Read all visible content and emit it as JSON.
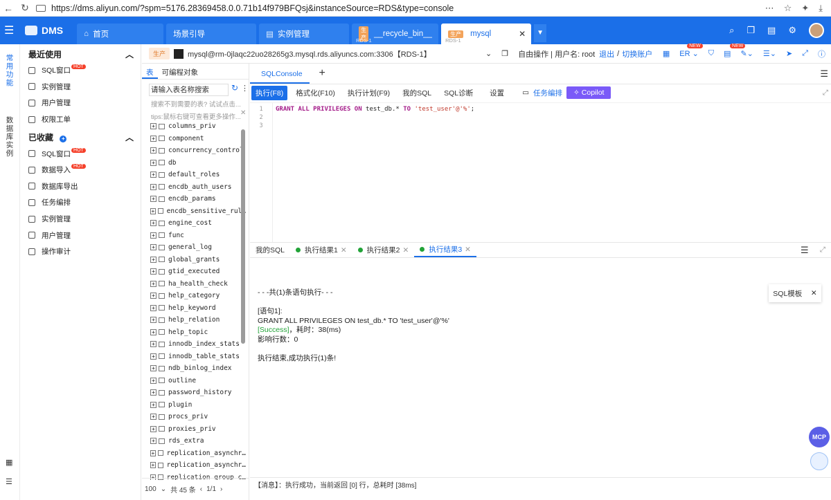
{
  "browser": {
    "url": "https://dms.aliyun.com/?spm=5176.28369458.0.0.71b14f979BFQsj&instanceSource=RDS&type=console"
  },
  "app": {
    "name": "DMS"
  },
  "tabs": [
    {
      "label": "首页",
      "tag": "",
      "sub": ""
    },
    {
      "label": "场景引导",
      "tag": "",
      "sub": ""
    },
    {
      "label": "实例管理",
      "tag": "",
      "sub": ""
    },
    {
      "label": "__recycle_bin__",
      "tag": "生产",
      "sub": "RDS-1"
    },
    {
      "label": "mysql",
      "tag": "生产",
      "sub": "RDS-1"
    }
  ],
  "leftrail": {
    "top": "常用功能",
    "bottom": "数据库实例"
  },
  "nav": {
    "recent_title": "最近使用",
    "recent": [
      {
        "label": "SQL窗口",
        "hot": "HOT"
      },
      {
        "label": "实例管理",
        "hot": ""
      },
      {
        "label": "用户管理",
        "hot": ""
      },
      {
        "label": "权限工单",
        "hot": ""
      }
    ],
    "fav_title": "已收藏",
    "favorites": [
      {
        "label": "SQL窗口",
        "hot": "HOT"
      },
      {
        "label": "数据导入",
        "hot": "HOT"
      },
      {
        "label": "数据库导出",
        "hot": ""
      },
      {
        "label": "任务编排",
        "hot": ""
      },
      {
        "label": "实例管理",
        "hot": ""
      },
      {
        "label": "用户管理",
        "hot": ""
      },
      {
        "label": "操作审计",
        "hot": ""
      }
    ]
  },
  "conn": {
    "env_tag": "生产",
    "string": "mysql@rm-0jlaqc22uo28265g3.mysql.rds.aliyuncs.com:3306【RDS-1】",
    "mode": "自由操作 | 用户名: root",
    "logout": "退出",
    "switch": "切换账户",
    "er": "ER",
    "new1": "NEW",
    "new2": "NEW"
  },
  "objects": {
    "tab_table": "表",
    "tab_prog": "可编程对象",
    "search_placeholder": "请输入表名称搜索",
    "hint1": "搜索不到需要的表? 试试点击...",
    "hint2": "tips:鼠标右键可查看更多操作...",
    "tables": [
      "columns_priv",
      "component",
      "concurrency_control",
      "db",
      "default_roles",
      "encdb_auth_users",
      "encdb_params",
      "encdb_sensitive_rul…",
      "engine_cost",
      "func",
      "general_log",
      "global_grants",
      "gtid_executed",
      "ha_health_check",
      "help_category",
      "help_keyword",
      "help_relation",
      "help_topic",
      "innodb_index_stats",
      "innodb_table_stats",
      "ndb_binlog_index",
      "outline",
      "password_history",
      "plugin",
      "procs_priv",
      "proxies_priv",
      "rds_extra",
      "replication_asynchr…",
      "replication_asynchr…",
      "replication_group_c…"
    ],
    "page_size": "100",
    "total": "共 45 条",
    "page": "1/1"
  },
  "editor": {
    "tab": "SQLConsole",
    "toolbar": {
      "run": "执行(F8)",
      "format": "格式化(F10)",
      "plan": "执行计划(F9)",
      "mysql": "我的SQL",
      "diag": "SQL诊断",
      "settings": "设置",
      "task": "任务编排",
      "copilot": "Copilot"
    },
    "lines": [
      "1",
      "2",
      "3"
    ],
    "code": {
      "kw1": "GRANT ALL PRIVILEGES ON",
      "t1": " test_db.* ",
      "kw2": "TO",
      "s1": " 'test_user'@'%'",
      "end": ";"
    }
  },
  "results": {
    "tabs": [
      "我的SQL",
      "执行结果1",
      "执行结果2",
      "执行结果3"
    ],
    "log": {
      "l1": "- - -共(1)条语句执行- - -",
      "l2": "[语句1]:",
      "l3": "GRANT ALL PRIVILEGES ON test_db.* TO 'test_user'@'%'",
      "l4a": "[Success]",
      "l4b": "，耗时：38(ms)",
      "l5": "影响行数：0",
      "l6": "执行结束,成功执行(1)条!"
    }
  },
  "message": "【消息】：执行成功，当前返回 [0] 行，总耗时 [38ms]",
  "float": {
    "template": "SQL模板",
    "mcp": "MCP"
  }
}
